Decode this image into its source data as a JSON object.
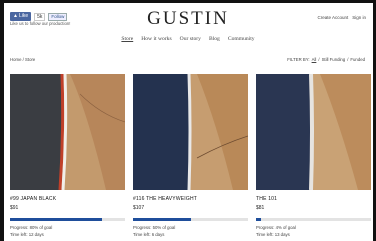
{
  "social": {
    "like_label": "Like",
    "like_count": "5k",
    "follow_label": "Follow",
    "note": "Like us to follow our production!"
  },
  "header": {
    "logo": "GUSTIN",
    "account_links": [
      "Create Account",
      "Sign in"
    ]
  },
  "nav": [
    "Store",
    "How it works",
    "Our story",
    "Blog",
    "Community"
  ],
  "breadcrumb": "Home / Store",
  "filters": {
    "label": "FILTER BY:",
    "options": [
      "All",
      "Still Funding",
      "Funded"
    ]
  },
  "products": [
    {
      "name": "#99 JAPAN BLACK",
      "price": "$91",
      "progress_text": "Progress: 80% of goal",
      "progress": 0.8,
      "time_left": "Time left: 12 days",
      "fabric_color": "#3a3d42",
      "selvedge_color": "#c0402a"
    },
    {
      "name": "#116 THE HEAVYWEIGHT",
      "price": "$107",
      "progress_text": "Progress: 50% of goal",
      "progress": 0.5,
      "time_left": "Time left: 6 days",
      "fabric_color": "#24324f",
      "selvedge_color": "#e8e8e8"
    },
    {
      "name": "THE 101",
      "price": "$81",
      "progress_text": "Progress: 4% of goal",
      "progress": 0.04,
      "time_left": "Time left: 13 days",
      "fabric_color": "#2a3652",
      "selvedge_color": "#e6e4e0"
    }
  ]
}
